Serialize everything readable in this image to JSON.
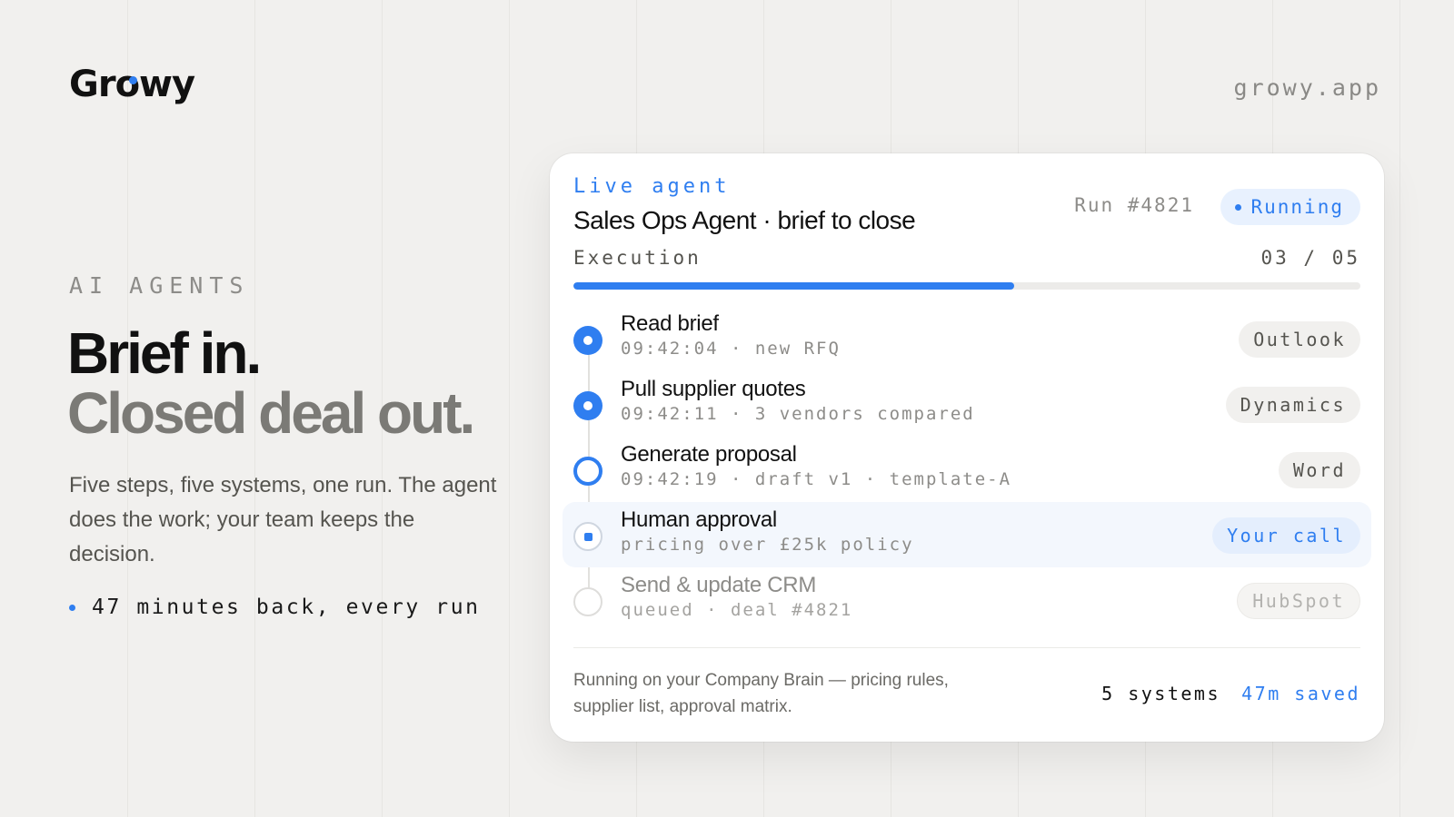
{
  "brand": {
    "logo_prefix": "Gr",
    "logo_o": "o",
    "logo_suffix": "wy",
    "domain": "growy.app",
    "accent": "#2f7ef0"
  },
  "hero": {
    "eyebrow": "AI AGENTS",
    "headline_1": "Brief in.",
    "headline_2": "Closed deal out.",
    "lead": "Five steps, five systems, one run. The agent does the work; your team keeps the decision.",
    "bullet": "47 minutes back, every run"
  },
  "card": {
    "eyebrow": "Live agent",
    "title": "Sales Ops Agent · brief to close",
    "run_id": "Run #4821",
    "status": "Running",
    "execution_label": "Execution",
    "execution_count": "03 / 05",
    "progress": 0.56,
    "steps": [
      {
        "title": "Read brief",
        "meta": "09:42:04 · new RFQ",
        "system": "Outlook",
        "state": "done"
      },
      {
        "title": "Pull supplier quotes",
        "meta": "09:42:11 · 3 vendors compared",
        "system": "Dynamics",
        "state": "done"
      },
      {
        "title": "Generate proposal",
        "meta": "09:42:19 · draft v1 · template-A",
        "system": "Word",
        "state": "active"
      },
      {
        "title": "Human approval",
        "meta": "pricing over £25k policy",
        "system": "Your call",
        "state": "approval"
      },
      {
        "title": "Send & update CRM",
        "meta": "queued · deal #4821",
        "system": "HubSpot",
        "state": "queued"
      }
    ],
    "footer": {
      "note": "Running on your Company Brain — pricing rules, supplier list, approval matrix.",
      "systems": "5 systems",
      "saved": "47m saved"
    }
  }
}
